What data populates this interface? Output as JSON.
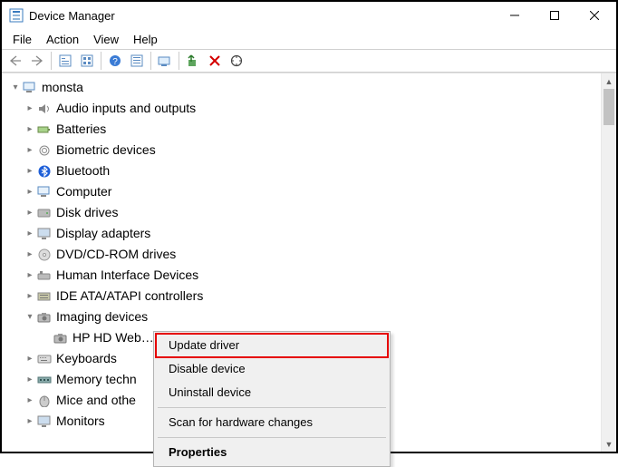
{
  "window": {
    "title": "Device Manager"
  },
  "menubar": {
    "file": "File",
    "action": "Action",
    "view": "View",
    "help": "Help"
  },
  "toolbar_icons": {
    "back": "back-icon",
    "forward": "forward-icon",
    "show_hidden": "show-hidden-icon",
    "view_icon": "view-icon",
    "help": "help-icon",
    "properties": "properties-icon",
    "scan": "scan-hardware-icon",
    "enable": "enable-icon",
    "disable": "disable-icon",
    "uninstall": "uninstall-icon"
  },
  "tree": {
    "root": {
      "label": "monsta"
    },
    "items": [
      {
        "label": "Audio inputs and outputs",
        "icon": "audio-icon"
      },
      {
        "label": "Batteries",
        "icon": "battery-icon"
      },
      {
        "label": "Biometric devices",
        "icon": "biometric-icon"
      },
      {
        "label": "Bluetooth",
        "icon": "bluetooth-icon"
      },
      {
        "label": "Computer",
        "icon": "computer-icon"
      },
      {
        "label": "Disk drives",
        "icon": "disk-icon"
      },
      {
        "label": "Display adapters",
        "icon": "display-icon"
      },
      {
        "label": "DVD/CD-ROM drives",
        "icon": "dvd-icon"
      },
      {
        "label": "Human Interface Devices",
        "icon": "hid-icon"
      },
      {
        "label": "IDE ATA/ATAPI controllers",
        "icon": "ide-icon"
      },
      {
        "label": "Imaging devices",
        "icon": "imaging-icon",
        "expanded": true,
        "children": [
          {
            "label": "HP HD Web…",
            "icon": "camera-icon"
          }
        ]
      },
      {
        "label": "Keyboards",
        "icon": "keyboard-icon"
      },
      {
        "label": "Memory techn",
        "icon": "memory-icon"
      },
      {
        "label": "Mice and othe",
        "icon": "mouse-icon"
      },
      {
        "label": "Monitors",
        "icon": "monitor-icon"
      }
    ]
  },
  "context_menu": {
    "update": "Update driver",
    "disable": "Disable device",
    "uninstall": "Uninstall device",
    "scan": "Scan for hardware changes",
    "properties": "Properties"
  }
}
